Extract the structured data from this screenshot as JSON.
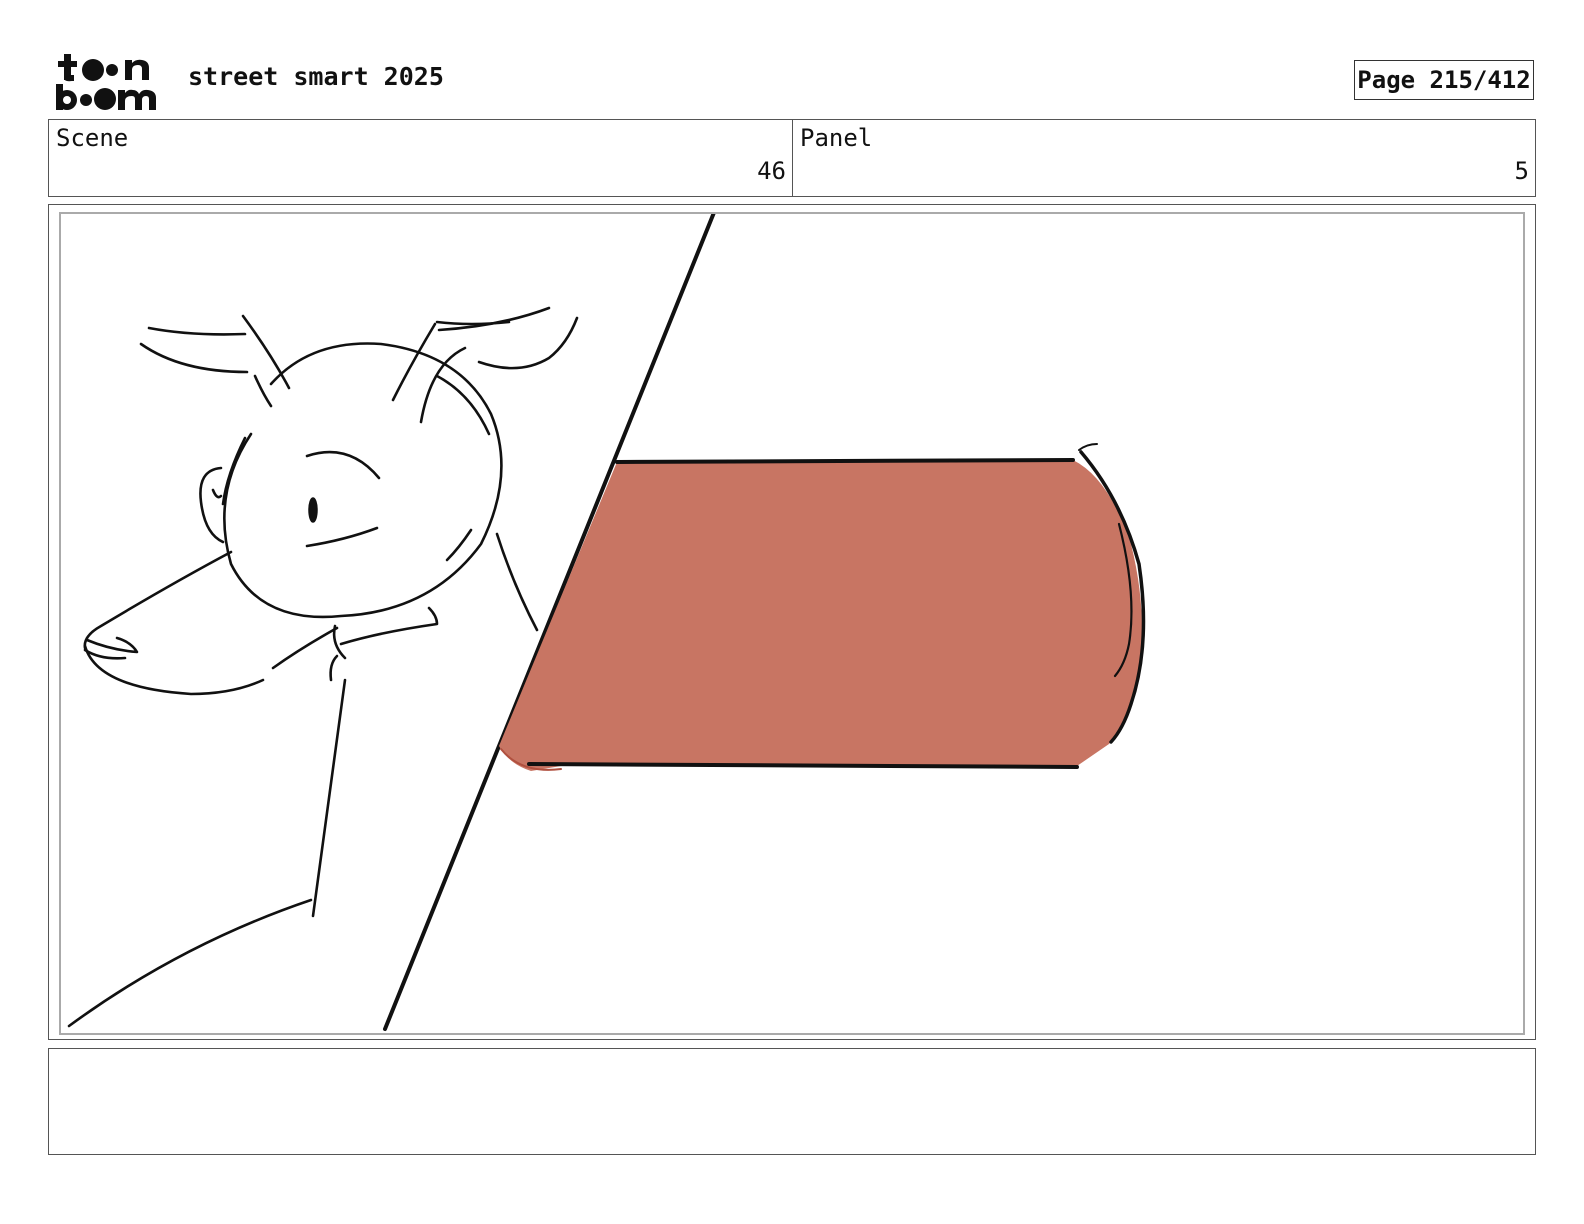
{
  "header": {
    "logo_text": "toon boom",
    "title": "street smart 2025",
    "page_label": "Page 215/412"
  },
  "info": {
    "scene_label": "Scene",
    "scene_value": "46",
    "panel_label": "Panel",
    "panel_value": "5"
  },
  "drawing": {
    "description_icon": "sketch-illustration",
    "fill_color": "#c87563",
    "line_color": "#111111"
  },
  "notes": {
    "text": ""
  }
}
